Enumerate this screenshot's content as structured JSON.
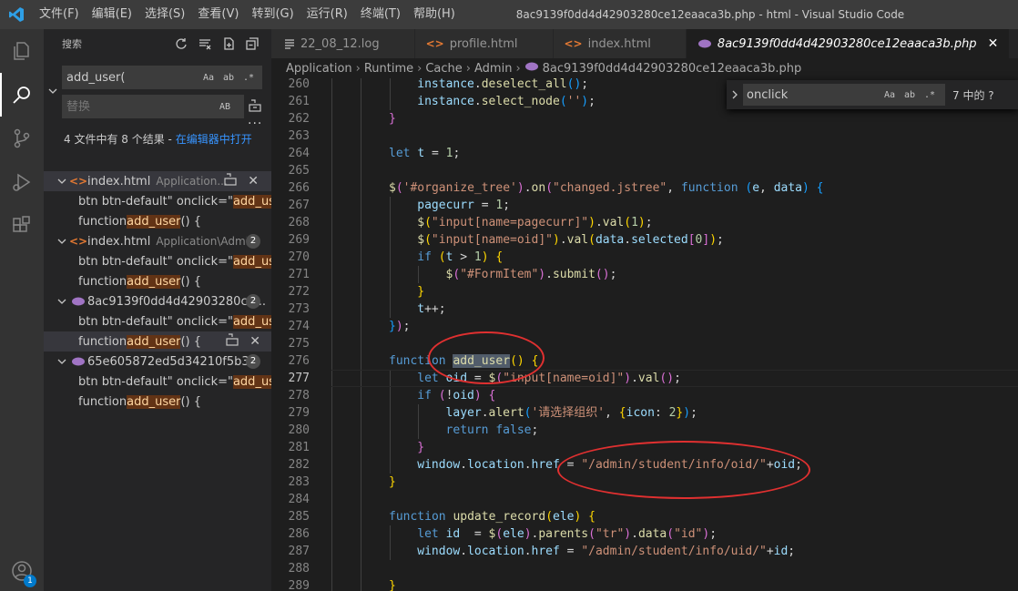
{
  "titlebar": {
    "menu": [
      "文件(F)",
      "编辑(E)",
      "选择(S)",
      "查看(V)",
      "转到(G)",
      "运行(R)",
      "终端(T)",
      "帮助(H)"
    ],
    "title": "8ac9139f0dd4d42903280ce12eaaca3b.php - html - Visual Studio Code"
  },
  "activity": {
    "badge": "1"
  },
  "sidebar": {
    "header": "搜索",
    "search_value": "add_user(",
    "replace_placeholder": "替换",
    "options": [
      "Aa",
      "ab",
      ".*"
    ],
    "replace_option": "AB",
    "summary_prefix": "4 文件中有 8 个结果 - ",
    "summary_link": "在编辑器中打开",
    "results": [
      {
        "name": "index.html",
        "path": "Application...",
        "count": "",
        "matches": [
          {
            "pre": "btn btn-default\" onclick=\"",
            "hl": "add_user",
            "post": "..."
          },
          {
            "pre": "function ",
            "hl": "add_user",
            "post": "() {"
          }
        ]
      },
      {
        "name": "index.html",
        "path": "Application\\Admi...",
        "count": "2",
        "matches": [
          {
            "pre": "btn btn-default\" onclick=\"",
            "hl": "add_user",
            "post": "..."
          },
          {
            "pre": "function ",
            "hl": "add_user",
            "post": "() {"
          }
        ]
      },
      {
        "name": "8ac9139f0dd4d42903280ce...",
        "path": "",
        "count": "2",
        "matches": [
          {
            "pre": "btn btn-default\" onclick=\"",
            "hl": "add_user",
            "post": "..."
          },
          {
            "pre": "function ",
            "hl": "add_user",
            "post": "() {"
          }
        ]
      },
      {
        "name": "65e605872ed5d34210f5b3...",
        "path": "",
        "count": "2",
        "matches": [
          {
            "pre": "btn btn-default\" onclick=\"",
            "hl": "add_user",
            "post": "..."
          },
          {
            "pre": "function ",
            "hl": "add_user",
            "post": "() {"
          }
        ]
      }
    ]
  },
  "tabs": [
    {
      "label": "22_08_12.log",
      "icon": "lines"
    },
    {
      "label": "profile.html",
      "icon": "html"
    },
    {
      "label": "index.html",
      "icon": "html"
    },
    {
      "label": "8ac9139f0dd4d42903280ce12eaaca3b.php",
      "icon": "php",
      "active": true
    }
  ],
  "breadcrumb": [
    "Application",
    "Runtime",
    "Cache",
    "Admin",
    "8ac9139f0dd4d42903280ce12eaaca3b.php"
  ],
  "find": {
    "value": "onclick",
    "result": "7 中的 ?",
    "options": [
      "Aa",
      "ab",
      ".*"
    ]
  },
  "code_lines": [
    {
      "n": "260",
      "indent": 1,
      "t": [
        [
          "var",
          "instance"
        ],
        [
          "pun",
          "."
        ],
        [
          "fn",
          "deselect_all"
        ],
        [
          "br3",
          "()"
        ],
        [
          "pun",
          ";"
        ]
      ]
    },
    {
      "n": "261",
      "indent": 1,
      "t": [
        [
          "var",
          "instance"
        ],
        [
          "pun",
          "."
        ],
        [
          "fn",
          "select_node"
        ],
        [
          "br3",
          "("
        ],
        [
          "str",
          "''"
        ],
        [
          "br3",
          ")"
        ],
        [
          "pun",
          ";"
        ]
      ]
    },
    {
      "n": "262",
      "indent": 0,
      "t": [
        [
          "br2",
          "}"
        ]
      ]
    },
    {
      "n": "263",
      "indent": 0,
      "t": []
    },
    {
      "n": "264",
      "indent": 0,
      "t": [
        [
          "kw",
          "let"
        ],
        [
          "pun",
          " "
        ],
        [
          "var",
          "t"
        ],
        [
          "pun",
          " = "
        ],
        [
          "num",
          "1"
        ],
        [
          "pun",
          ";"
        ]
      ]
    },
    {
      "n": "265",
      "indent": 0,
      "t": []
    },
    {
      "n": "266",
      "indent": 0,
      "t": [
        [
          "fn",
          "$"
        ],
        [
          "br2",
          "("
        ],
        [
          "str",
          "'#organize_tree'"
        ],
        [
          "br2",
          ")"
        ],
        [
          "pun",
          "."
        ],
        [
          "fn",
          "on"
        ],
        [
          "br2",
          "("
        ],
        [
          "str",
          "\"changed.jstree\""
        ],
        [
          "pun",
          ", "
        ],
        [
          "kw",
          "function"
        ],
        [
          "pun",
          " "
        ],
        [
          "br3",
          "("
        ],
        [
          "var",
          "e"
        ],
        [
          "pun",
          ", "
        ],
        [
          "var",
          "data"
        ],
        [
          "br3",
          ")"
        ],
        [
          "pun",
          " "
        ],
        [
          "br3",
          "{"
        ]
      ]
    },
    {
      "n": "267",
      "indent": 1,
      "t": [
        [
          "var",
          "pagecurr"
        ],
        [
          "pun",
          " = "
        ],
        [
          "num",
          "1"
        ],
        [
          "pun",
          ";"
        ]
      ]
    },
    {
      "n": "268",
      "indent": 1,
      "t": [
        [
          "fn",
          "$"
        ],
        [
          "br1",
          "("
        ],
        [
          "str",
          "\"input[name=pagecurr]\""
        ],
        [
          "br1",
          ")"
        ],
        [
          "pun",
          "."
        ],
        [
          "fn",
          "val"
        ],
        [
          "br1",
          "("
        ],
        [
          "num",
          "1"
        ],
        [
          "br1",
          ")"
        ],
        [
          "pun",
          ";"
        ]
      ]
    },
    {
      "n": "269",
      "indent": 1,
      "t": [
        [
          "fn",
          "$"
        ],
        [
          "br1",
          "("
        ],
        [
          "str",
          "\"input[name=oid]\""
        ],
        [
          "br1",
          ")"
        ],
        [
          "pun",
          "."
        ],
        [
          "fn",
          "val"
        ],
        [
          "br1",
          "("
        ],
        [
          "var",
          "data"
        ],
        [
          "pun",
          "."
        ],
        [
          "var",
          "selected"
        ],
        [
          "br2",
          "["
        ],
        [
          "num",
          "0"
        ],
        [
          "br2",
          "]"
        ],
        [
          "br1",
          ")"
        ],
        [
          "pun",
          ";"
        ]
      ]
    },
    {
      "n": "270",
      "indent": 1,
      "t": [
        [
          "kw",
          "if"
        ],
        [
          "pun",
          " "
        ],
        [
          "br1",
          "("
        ],
        [
          "var",
          "t"
        ],
        [
          "pun",
          " > "
        ],
        [
          "num",
          "1"
        ],
        [
          "br1",
          ")"
        ],
        [
          "pun",
          " "
        ],
        [
          "br1",
          "{"
        ]
      ]
    },
    {
      "n": "271",
      "indent": 2,
      "t": [
        [
          "fn",
          "$"
        ],
        [
          "br2",
          "("
        ],
        [
          "str",
          "\"#FormItem\""
        ],
        [
          "br2",
          ")"
        ],
        [
          "pun",
          "."
        ],
        [
          "fn",
          "submit"
        ],
        [
          "br2",
          "()"
        ],
        [
          "pun",
          ";"
        ]
      ]
    },
    {
      "n": "272",
      "indent": 1,
      "t": [
        [
          "br1",
          "}"
        ]
      ]
    },
    {
      "n": "273",
      "indent": 1,
      "t": [
        [
          "var",
          "t"
        ],
        [
          "pun",
          "++;"
        ]
      ]
    },
    {
      "n": "274",
      "indent": 0,
      "t": [
        [
          "br3",
          "}"
        ],
        [
          "br2",
          ")"
        ],
        [
          "pun",
          ";"
        ]
      ]
    },
    {
      "n": "275",
      "indent": 0,
      "t": []
    },
    {
      "n": "276",
      "indent": 0,
      "t": [
        [
          "kw",
          "function"
        ],
        [
          "pun",
          " "
        ],
        [
          "fnhl",
          "add_user"
        ],
        [
          "br1",
          "()"
        ],
        [
          "pun",
          " "
        ],
        [
          "br1",
          "{"
        ]
      ]
    },
    {
      "n": "277",
      "indent": 1,
      "cur": true,
      "t": [
        [
          "kw",
          "let"
        ],
        [
          "pun",
          " "
        ],
        [
          "var",
          "oid"
        ],
        [
          "pun",
          " = "
        ],
        [
          "fn",
          "$"
        ],
        [
          "br2",
          "("
        ],
        [
          "str",
          "\"input[name=oid]\""
        ],
        [
          "br2",
          ")"
        ],
        [
          "pun",
          "."
        ],
        [
          "fn",
          "val"
        ],
        [
          "br2",
          "()"
        ],
        [
          "pun",
          ";"
        ]
      ]
    },
    {
      "n": "278",
      "indent": 1,
      "t": [
        [
          "kw",
          "if"
        ],
        [
          "pun",
          " "
        ],
        [
          "br2",
          "("
        ],
        [
          "pun",
          "!"
        ],
        [
          "var",
          "oid"
        ],
        [
          "br2",
          ")"
        ],
        [
          "pun",
          " "
        ],
        [
          "br2",
          "{"
        ]
      ]
    },
    {
      "n": "279",
      "indent": 2,
      "t": [
        [
          "var",
          "layer"
        ],
        [
          "pun",
          "."
        ],
        [
          "fn",
          "alert"
        ],
        [
          "br3",
          "("
        ],
        [
          "str",
          "'请选择组织'"
        ],
        [
          "pun",
          ", "
        ],
        [
          "br1",
          "{"
        ],
        [
          "var",
          "icon"
        ],
        [
          "pun",
          ": "
        ],
        [
          "num",
          "2"
        ],
        [
          "br1",
          "}"
        ],
        [
          "br3",
          ")"
        ],
        [
          "pun",
          ";"
        ]
      ]
    },
    {
      "n": "280",
      "indent": 2,
      "t": [
        [
          "kw",
          "return"
        ],
        [
          "pun",
          " "
        ],
        [
          "kw",
          "false"
        ],
        [
          "pun",
          ";"
        ]
      ]
    },
    {
      "n": "281",
      "indent": 1,
      "t": [
        [
          "br2",
          "}"
        ]
      ]
    },
    {
      "n": "282",
      "indent": 1,
      "t": [
        [
          "var",
          "window"
        ],
        [
          "pun",
          "."
        ],
        [
          "var",
          "location"
        ],
        [
          "pun",
          "."
        ],
        [
          "var",
          "href"
        ],
        [
          "pun",
          " = "
        ],
        [
          "str",
          "\"/admin/student/info/oid/\""
        ],
        [
          "pun",
          "+"
        ],
        [
          "var",
          "oid"
        ],
        [
          "pun",
          ";"
        ]
      ]
    },
    {
      "n": "283",
      "indent": 0,
      "t": [
        [
          "br1",
          "}"
        ]
      ]
    },
    {
      "n": "284",
      "indent": 0,
      "t": []
    },
    {
      "n": "285",
      "indent": 0,
      "t": [
        [
          "kw",
          "function"
        ],
        [
          "pun",
          " "
        ],
        [
          "fn",
          "update_record"
        ],
        [
          "br1",
          "("
        ],
        [
          "var",
          "ele"
        ],
        [
          "br1",
          ")"
        ],
        [
          "pun",
          " "
        ],
        [
          "br1",
          "{"
        ]
      ]
    },
    {
      "n": "286",
      "indent": 1,
      "t": [
        [
          "kw",
          "let"
        ],
        [
          "pun",
          " "
        ],
        [
          "var",
          "id"
        ],
        [
          "pun",
          "  = "
        ],
        [
          "fn",
          "$"
        ],
        [
          "br2",
          "("
        ],
        [
          "var",
          "ele"
        ],
        [
          "br2",
          ")"
        ],
        [
          "pun",
          "."
        ],
        [
          "fn",
          "parents"
        ],
        [
          "br2",
          "("
        ],
        [
          "str",
          "\"tr\""
        ],
        [
          "br2",
          ")"
        ],
        [
          "pun",
          "."
        ],
        [
          "fn",
          "data"
        ],
        [
          "br2",
          "("
        ],
        [
          "str",
          "\"id\""
        ],
        [
          "br2",
          ")"
        ],
        [
          "pun",
          ";"
        ]
      ]
    },
    {
      "n": "287",
      "indent": 1,
      "t": [
        [
          "var",
          "window"
        ],
        [
          "pun",
          "."
        ],
        [
          "var",
          "location"
        ],
        [
          "pun",
          "."
        ],
        [
          "var",
          "href"
        ],
        [
          "pun",
          " = "
        ],
        [
          "str",
          "\"/admin/student/info/uid/\""
        ],
        [
          "pun",
          "+"
        ],
        [
          "var",
          "id"
        ],
        [
          "pun",
          ";"
        ]
      ]
    },
    {
      "n": "288",
      "indent": 0,
      "t": []
    },
    {
      "n": "289",
      "indent": 0,
      "t": [
        [
          "br1",
          "}"
        ]
      ]
    }
  ],
  "colors": {
    "accent": "#007acc",
    "annotation": "#e03030"
  }
}
